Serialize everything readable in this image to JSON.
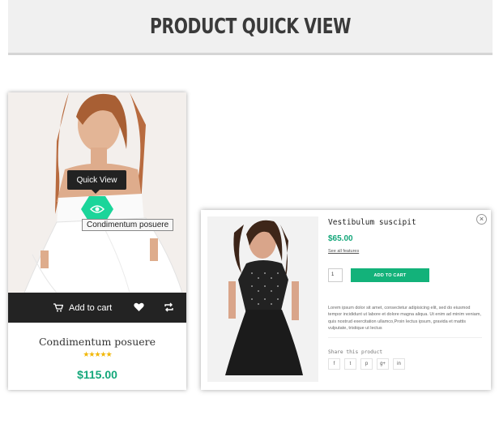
{
  "banner": {
    "title": "PRODUCT QUICK VIEW"
  },
  "card": {
    "tooltip": "Quick View",
    "title_tip": "Condimentum posuere",
    "add_to_cart": "Add to cart",
    "name": "Condimentum posuere",
    "rating": 5,
    "stars": "★★★★★",
    "price": "$115.00",
    "icons": [
      "eye-icon",
      "cart-icon",
      "heart-icon",
      "compare-icon"
    ]
  },
  "quickview": {
    "close": "×",
    "title": "Vestibulum suscipit",
    "price": "$65.00",
    "features_link": "See all features",
    "qty": "1",
    "add_to_cart": "ADD TO CART",
    "description": "Lorem ipsum dolor sit amet, consectetur adipisicing elit, sed do eiusmod tempor incididunt ut labore et dolore magna aliqua. Ut enim ad minim veniam, quis nostrud exercitation ullamco,Proin lectus ipsum, gravida et mattis vulputate, tristique ut lectus",
    "share_label": "Share this product",
    "socials": [
      {
        "name": "facebook",
        "glyph": "f"
      },
      {
        "name": "twitter",
        "glyph": "t"
      },
      {
        "name": "pinterest",
        "glyph": "p"
      },
      {
        "name": "google-plus",
        "glyph": "g+"
      },
      {
        "name": "linkedin",
        "glyph": "in"
      }
    ]
  },
  "colors": {
    "accent": "#1bd59a",
    "price": "#14a77a",
    "button": "#13b27a",
    "bar": "#232323"
  }
}
